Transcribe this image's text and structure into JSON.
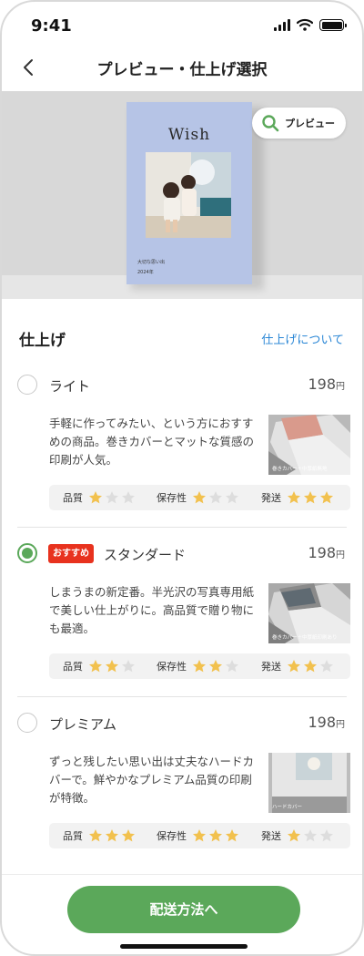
{
  "status_bar": {
    "time": "9:41"
  },
  "header": {
    "title": "プレビュー・仕上げ選択"
  },
  "preview": {
    "book_title": "Wish",
    "book_subtitle_1": "大切な思い出",
    "book_subtitle_2": "2024年",
    "button_label": "プレビュー"
  },
  "finish_section": {
    "title": "仕上げ",
    "link": "仕上げについて"
  },
  "options": [
    {
      "name": "ライト",
      "price": "198",
      "price_unit": "円",
      "description": "手軽に作ってみたい、という方におすすめの商品。巻きカバーとマットな質感の印刷が人気。",
      "thumb_caption": "巻きカバー＋中厚紙無地",
      "selected": false,
      "ratings": [
        {
          "label": "品質",
          "stars": 1
        },
        {
          "label": "保存性",
          "stars": 1
        },
        {
          "label": "発送",
          "stars": 3
        }
      ]
    },
    {
      "name": "スタンダード",
      "badge": "おすすめ",
      "price": "198",
      "price_unit": "円",
      "description": "しまうまの新定番。半光沢の写真専用紙で美しい仕上がりに。高品質で贈り物にも最適。",
      "thumb_caption": "巻きカバー＋中厚紙印刷あり",
      "selected": true,
      "ratings": [
        {
          "label": "品質",
          "stars": 2
        },
        {
          "label": "保存性",
          "stars": 2
        },
        {
          "label": "発送",
          "stars": 2
        }
      ]
    },
    {
      "name": "プレミアム",
      "price": "198",
      "price_unit": "円",
      "description": "ずっと残したい思い出は丈夫なハードカバーで。鮮やかなプレミアム品質の印刷が特徴。",
      "thumb_caption": "ハードカバー",
      "selected": false,
      "ratings": [
        {
          "label": "品質",
          "stars": 3
        },
        {
          "label": "保存性",
          "stars": 3
        },
        {
          "label": "発送",
          "stars": 1
        }
      ]
    }
  ],
  "footer": {
    "cta_label": "配送方法へ"
  },
  "colors": {
    "accent": "#5ba85a",
    "link": "#2b87d6",
    "badge": "#e8321e",
    "star_on": "#f2c14e",
    "star_off": "#dddddd",
    "book_cover": "#b6c4e6"
  },
  "icons": [
    "back-chevron-icon",
    "search-icon",
    "signal-icon",
    "wifi-icon",
    "battery-icon",
    "star-icon"
  ]
}
